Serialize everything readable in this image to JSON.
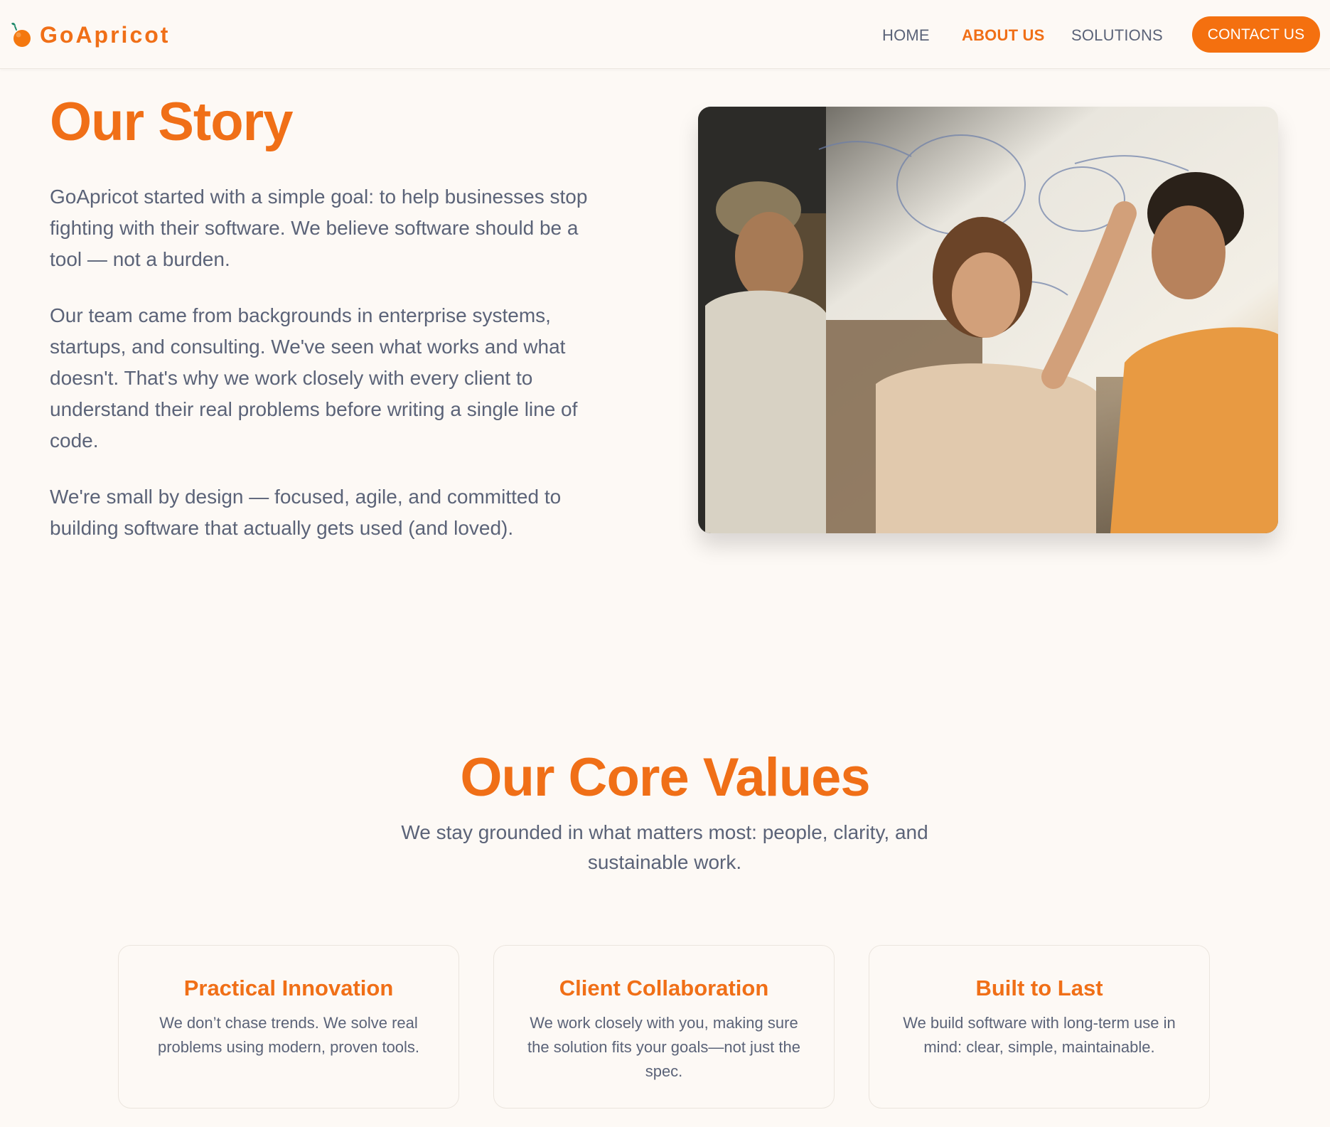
{
  "brand": {
    "name": "GoApricot",
    "accent_color": "#f06f17",
    "logo_icon": "apricot-icon"
  },
  "nav": {
    "items": [
      {
        "label": "HOME",
        "active": false
      },
      {
        "label": "ABOUT US",
        "active": true
      },
      {
        "label": "SOLUTIONS",
        "active": false
      }
    ],
    "contact_label": "CONTACT US"
  },
  "story": {
    "title": "Our Story",
    "paragraphs": [
      "GoApricot started with a simple goal: to help businesses stop fighting with their software. We believe software should be a tool — not a burden.",
      "Our team came from backgrounds in enterprise systems, startups, and consulting. We've seen what works and what doesn't. That's why we work closely with every client to understand their real problems before writing a single line of code.",
      "We're small by design — focused, agile, and committed to building software that actually gets used (and loved)."
    ],
    "photo_icon": "team-photo"
  },
  "values": {
    "title": "Our Core Values",
    "subtitle": "We stay grounded in what matters most: people, clarity, and sustainable work.",
    "cards": [
      {
        "title": "Practical Innovation",
        "text": "We don’t chase trends. We solve real problems using modern, proven tools."
      },
      {
        "title": "Client Collaboration",
        "text": "We work closely with you, making sure the solution fits your goals—not just the spec."
      },
      {
        "title": "Built to Last",
        "text": "We build software with long-term use in mind: clear, simple, maintainable."
      }
    ]
  }
}
